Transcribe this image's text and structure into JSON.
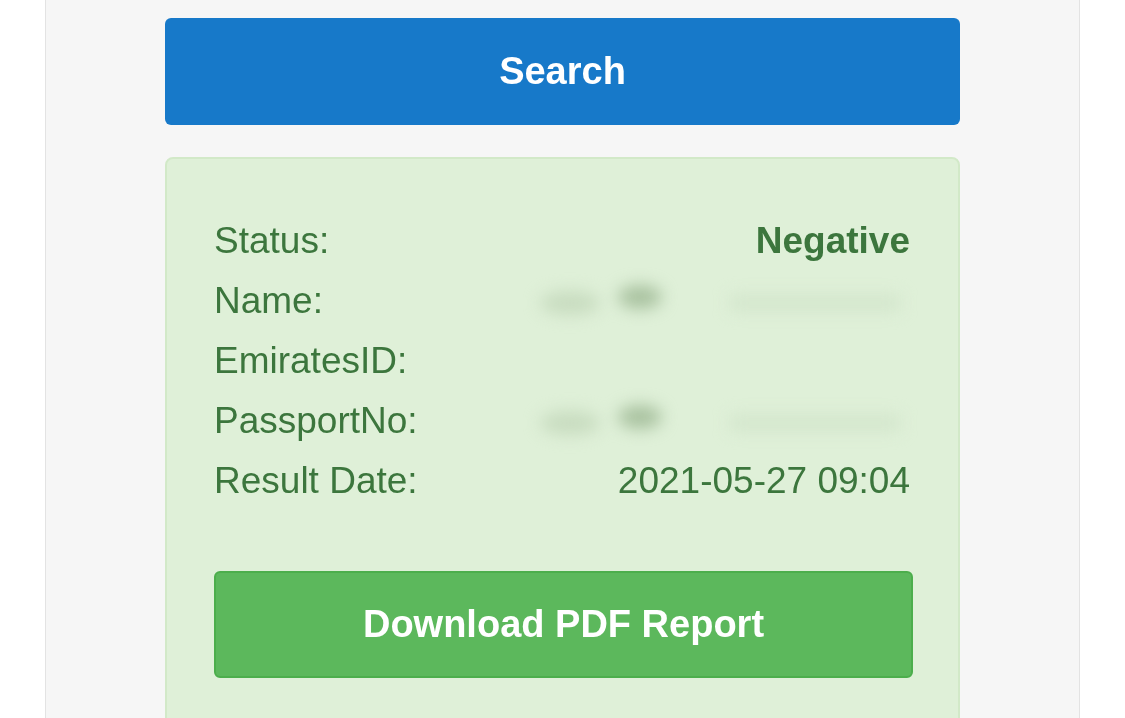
{
  "search_button": {
    "label": "Search"
  },
  "result": {
    "rows": [
      {
        "label": "Status:",
        "value": "Negative",
        "kind": "status"
      },
      {
        "label": "Name:",
        "kind": "redacted"
      },
      {
        "label": "EmiratesID:",
        "kind": "text"
      },
      {
        "label": "PassportNo:",
        "kind": "redacted"
      },
      {
        "label": "Result Date:",
        "value": "2021-05-27 09:04",
        "kind": "text"
      }
    ],
    "download_button": {
      "label": "Download PDF Report"
    }
  }
}
